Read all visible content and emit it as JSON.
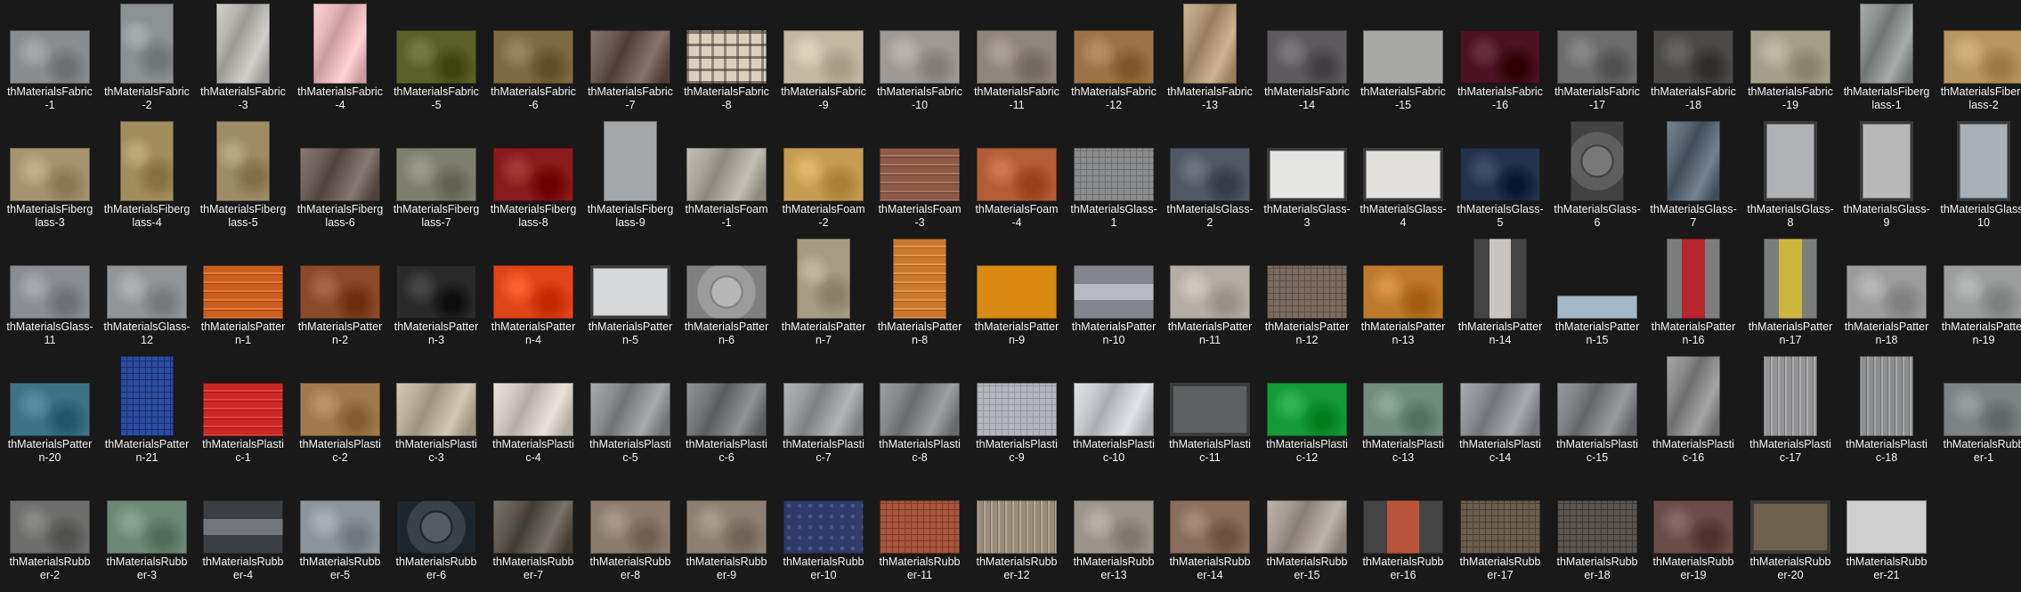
{
  "items": [
    {
      "line1": "thMaterialsFabric",
      "line2": "-1",
      "shape": "wide",
      "color": "#8a8d90",
      "texture": "noise"
    },
    {
      "line1": "thMaterialsFabric",
      "line2": "-2",
      "shape": "tall",
      "color": "#8c9194",
      "texture": "noise"
    },
    {
      "line1": "thMaterialsFabric",
      "line2": "-3",
      "shape": "tall",
      "color": "#b8b6b1",
      "texture": "wrinkle"
    },
    {
      "line1": "thMaterialsFabric",
      "line2": "-4",
      "shape": "tall",
      "color": "#e6b8bc",
      "texture": "wrinkle"
    },
    {
      "line1": "thMaterialsFabric",
      "line2": "-5",
      "shape": "wide",
      "color": "#5a5f2a",
      "texture": "noise"
    },
    {
      "line1": "thMaterialsFabric",
      "line2": "-6",
      "shape": "wide",
      "color": "#7c6a43",
      "texture": "noise"
    },
    {
      "line1": "thMaterialsFabric",
      "line2": "-7",
      "shape": "wide",
      "color": "#6a5a52",
      "texture": "wrinkle"
    },
    {
      "line1": "thMaterialsFabric",
      "line2": "-8",
      "shape": "wide",
      "color": "#d9d1bd",
      "texture": "plaid"
    },
    {
      "line1": "thMaterialsFabric",
      "line2": "-9",
      "shape": "wide",
      "color": "#c5b8a3",
      "texture": "noise"
    },
    {
      "line1": "thMaterialsFabric",
      "line2": "-10",
      "shape": "wide",
      "color": "#9e9994",
      "texture": "noise"
    },
    {
      "line1": "thMaterialsFabric",
      "line2": "-11",
      "shape": "wide",
      "color": "#8f867b",
      "texture": "noise"
    },
    {
      "line1": "thMaterialsFabric",
      "line2": "-12",
      "shape": "wide",
      "color": "#9b7347",
      "texture": "noise"
    },
    {
      "line1": "thMaterialsFabric",
      "line2": "-13",
      "shape": "tall",
      "color": "#b49a7a",
      "texture": "wrinkle"
    },
    {
      "line1": "thMaterialsFabric",
      "line2": "-14",
      "shape": "wide",
      "color": "#5d5b60",
      "texture": "noise"
    },
    {
      "line1": "thMaterialsFabric",
      "line2": "-15",
      "shape": "wide",
      "color": "#a8a8a6",
      "texture": "flat"
    },
    {
      "line1": "thMaterialsFabric",
      "line2": "-16",
      "shape": "wide",
      "color": "#4a1222",
      "texture": "noise"
    },
    {
      "line1": "thMaterialsFabric",
      "line2": "-17",
      "shape": "wide",
      "color": "#6c6c6c",
      "texture": "noise"
    },
    {
      "line1": "thMaterialsFabric",
      "line2": "-18",
      "shape": "wide",
      "color": "#4b4a48",
      "texture": "noise"
    },
    {
      "line1": "thMaterialsFabric",
      "line2": "-19",
      "shape": "wide",
      "color": "#a49f8a",
      "texture": "noise"
    },
    {
      "line1": "thMaterialsFiberg",
      "line2": "lass-1",
      "shape": "tall",
      "color": "#8d9290",
      "texture": "wrinkle"
    },
    {
      "line1": "thMaterialsFiberg",
      "line2": "lass-2",
      "shape": "wide",
      "color": "#b89660",
      "texture": "noise"
    },
    {
      "line1": "thMaterialsFiberg",
      "line2": "lass-3",
      "shape": "wide",
      "color": "#a59470",
      "texture": "noise"
    },
    {
      "line1": "thMaterialsFiberg",
      "line2": "lass-4",
      "shape": "tall",
      "color": "#a08e5c",
      "texture": "noise"
    },
    {
      "line1": "thMaterialsFiberg",
      "line2": "lass-5",
      "shape": "tall",
      "color": "#9d8c66",
      "texture": "noise"
    },
    {
      "line1": "thMaterialsFiberg",
      "line2": "lass-6",
      "shape": "wide",
      "color": "#6c5f59",
      "texture": "wrinkle"
    },
    {
      "line1": "thMaterialsFiberg",
      "line2": "lass-7",
      "shape": "wide",
      "color": "#7e7f6e",
      "texture": "noise"
    },
    {
      "line1": "thMaterialsFiberg",
      "line2": "lass-8",
      "shape": "wide",
      "color": "#8a1a1c",
      "texture": "noise"
    },
    {
      "line1": "thMaterialsFiberg",
      "line2": "lass-9",
      "shape": "tall",
      "color": "#a5a8ab",
      "texture": "flat"
    },
    {
      "line1": "thMaterialsFoam",
      "line2": "-1",
      "shape": "wide",
      "color": "#a9a59b",
      "texture": "wrinkle"
    },
    {
      "line1": "thMaterialsFoam",
      "line2": "-2",
      "shape": "wide",
      "color": "#c69b52",
      "texture": "noise"
    },
    {
      "line1": "thMaterialsFoam",
      "line2": "-3",
      "shape": "wide",
      "color": "#8d5a48",
      "texture": "stripes"
    },
    {
      "line1": "thMaterialsFoam",
      "line2": "-4",
      "shape": "wide",
      "color": "#b25d35",
      "texture": "noise"
    },
    {
      "line1": "thMaterialsGlass-",
      "line2": "1",
      "shape": "wide",
      "color": "#8a8b8d",
      "texture": "grid"
    },
    {
      "line1": "thMaterialsGlass-",
      "line2": "2",
      "shape": "wide",
      "color": "#505866",
      "texture": "noise"
    },
    {
      "line1": "thMaterialsGlass-",
      "line2": "3",
      "shape": "wide",
      "color": "#e5e5e3",
      "texture": "frame"
    },
    {
      "line1": "thMaterialsGlass-",
      "line2": "4",
      "shape": "wide",
      "color": "#e1e0dc",
      "texture": "frame"
    },
    {
      "line1": "thMaterialsGlass-",
      "line2": "5",
      "shape": "wide",
      "color": "#24324b",
      "texture": "noise"
    },
    {
      "line1": "thMaterialsGlass-",
      "line2": "6",
      "shape": "tall",
      "color": "#5d5e5d",
      "texture": "circle"
    },
    {
      "line1": "thMaterialsGlass-",
      "line2": "7",
      "shape": "tall",
      "color": "#5b6976",
      "texture": "wrinkle"
    },
    {
      "line1": "thMaterialsGlass-",
      "line2": "8",
      "shape": "tall",
      "color": "#b0b2b5",
      "texture": "frame"
    },
    {
      "line1": "thMaterialsGlass-",
      "line2": "9",
      "shape": "tall",
      "color": "#b8b8b8",
      "texture": "frame"
    },
    {
      "line1": "thMaterialsGlass-",
      "line2": "10",
      "shape": "tall",
      "color": "#a8b0b8",
      "texture": "frame"
    },
    {
      "line1": "thMaterialsGlass-",
      "line2": "11",
      "shape": "wide",
      "color": "#8a8d91",
      "texture": "noise"
    },
    {
      "line1": "thMaterialsGlass-",
      "line2": "12",
      "shape": "wide",
      "color": "#939699",
      "texture": "noise"
    },
    {
      "line1": "thMaterialsPatter",
      "line2": "n-1",
      "shape": "wide",
      "color": "#c95f22",
      "texture": "stripes"
    },
    {
      "line1": "thMaterialsPatter",
      "line2": "n-2",
      "shape": "wide",
      "color": "#8b4a2b",
      "texture": "noise"
    },
    {
      "line1": "thMaterialsPatter",
      "line2": "n-3",
      "shape": "wide",
      "color": "#2a2a2a",
      "texture": "noise"
    },
    {
      "line1": "thMaterialsPatter",
      "line2": "n-4",
      "shape": "wide",
      "color": "#e04419",
      "texture": "noise"
    },
    {
      "line1": "thMaterialsPatter",
      "line2": "n-5",
      "shape": "wide",
      "color": "#d8d9db",
      "texture": "frame"
    },
    {
      "line1": "thMaterialsPatter",
      "line2": "n-6",
      "shape": "wide",
      "color": "#9c9c9c",
      "texture": "circle"
    },
    {
      "line1": "thMaterialsPatter",
      "line2": "n-7",
      "shape": "tall",
      "color": "#a69c86",
      "texture": "noise"
    },
    {
      "line1": "thMaterialsPatter",
      "line2": "n-8",
      "shape": "tall",
      "color": "#c9792e",
      "texture": "stripes"
    },
    {
      "line1": "thMaterialsPatter",
      "line2": "n-9",
      "shape": "wide",
      "color": "#d88a12",
      "texture": "flat"
    },
    {
      "line1": "thMaterialsPatter",
      "line2": "n-10",
      "shape": "wide",
      "color": "#9ea2a8",
      "texture": "band"
    },
    {
      "line1": "thMaterialsPatter",
      "line2": "n-11",
      "shape": "wide",
      "color": "#b3ada3",
      "texture": "noise"
    },
    {
      "line1": "thMaterialsPatter",
      "line2": "n-12",
      "shape": "wide",
      "color": "#7a6a5f",
      "texture": "grid"
    },
    {
      "line1": "thMaterialsPatter",
      "line2": "n-13",
      "shape": "wide",
      "color": "#bd7a2d",
      "texture": "noise"
    },
    {
      "line1": "thMaterialsPatter",
      "line2": "n-14",
      "shape": "tall",
      "color": "#c8c4bf",
      "texture": "cone"
    },
    {
      "line1": "thMaterialsPatter",
      "line2": "n-15",
      "shape": "low",
      "color": "#a5b8c8",
      "texture": "flat"
    },
    {
      "line1": "thMaterialsPatter",
      "line2": "n-16",
      "shape": "tall",
      "color": "#b4262b",
      "texture": "band-v"
    },
    {
      "line1": "thMaterialsPatter",
      "line2": "n-17",
      "shape": "tall",
      "color": "#cdb63b",
      "texture": "band-v"
    },
    {
      "line1": "thMaterialsPatter",
      "line2": "n-18",
      "shape": "wide",
      "color": "#9c9c9c",
      "texture": "noise"
    },
    {
      "line1": "thMaterialsPatter",
      "line2": "n-19",
      "shape": "wide",
      "color": "#9b9d9d",
      "texture": "noise"
    },
    {
      "line1": "thMaterialsPatter",
      "line2": "n-20",
      "shape": "wide",
      "color": "#3f7184",
      "texture": "noise"
    },
    {
      "line1": "thMaterialsPatter",
      "line2": "n-21",
      "shape": "tall",
      "color": "#2e4c9a",
      "texture": "grid"
    },
    {
      "line1": "thMaterialsPlasti",
      "line2": "c-1",
      "shape": "wide",
      "color": "#c72a28",
      "texture": "stripes"
    },
    {
      "line1": "thMaterialsPlasti",
      "line2": "c-2",
      "shape": "wide",
      "color": "#9e7a4e",
      "texture": "noise"
    },
    {
      "line1": "thMaterialsPlasti",
      "line2": "c-3",
      "shape": "wide",
      "color": "#b7ae9c",
      "texture": "wrinkle"
    },
    {
      "line1": "thMaterialsPlasti",
      "line2": "c-4",
      "shape": "wide",
      "color": "#cfc9c1",
      "texture": "wrinkle"
    },
    {
      "line1": "thMaterialsPlasti",
      "line2": "c-5",
      "shape": "wide",
      "color": "#8e8f93",
      "texture": "wrinkle"
    },
    {
      "line1": "thMaterialsPlasti",
      "line2": "c-6",
      "shape": "wide",
      "color": "#77787c",
      "texture": "wrinkle"
    },
    {
      "line1": "thMaterialsPlasti",
      "line2": "c-7",
      "shape": "wide",
      "color": "#9a9b9e",
      "texture": "wrinkle"
    },
    {
      "line1": "thMaterialsPlasti",
      "line2": "c-8",
      "shape": "wide",
      "color": "#85868a",
      "texture": "wrinkle"
    },
    {
      "line1": "thMaterialsPlasti",
      "line2": "c-9",
      "shape": "wide",
      "color": "#b4b6bd",
      "texture": "grid"
    },
    {
      "line1": "thMaterialsPlasti",
      "line2": "c-10",
      "shape": "wide",
      "color": "#c7c9cf",
      "texture": "wrinkle"
    },
    {
      "line1": "thMaterialsPlasti",
      "line2": "c-11",
      "shape": "wide",
      "color": "#5f6062",
      "texture": "frame"
    },
    {
      "line1": "thMaterialsPlasti",
      "line2": "c-12",
      "shape": "wide",
      "color": "#159a3a",
      "texture": "noise"
    },
    {
      "line1": "thMaterialsPlasti",
      "line2": "c-13",
      "shape": "wide",
      "color": "#708c7d",
      "texture": "noise"
    },
    {
      "line1": "thMaterialsPlasti",
      "line2": "c-14",
      "shape": "wide",
      "color": "#8e9095",
      "texture": "wrinkle"
    },
    {
      "line1": "thMaterialsPlasti",
      "line2": "c-15",
      "shape": "wide",
      "color": "#7f8185",
      "texture": "wrinkle"
    },
    {
      "line1": "thMaterialsPlasti",
      "line2": "c-16",
      "shape": "tall",
      "color": "#8b8b8c",
      "texture": "wrinkle"
    },
    {
      "line1": "thMaterialsPlasti",
      "line2": "c-17",
      "shape": "tall",
      "color": "#939395",
      "texture": "stripes-v"
    },
    {
      "line1": "thMaterialsPlasti",
      "line2": "c-18",
      "shape": "tall",
      "color": "#8d8e90",
      "texture": "stripes-v"
    },
    {
      "line1": "thMaterialsRubb",
      "line2": "er-1",
      "shape": "wide",
      "color": "#7d8384",
      "texture": "noise"
    },
    {
      "line1": "thMaterialsRubb",
      "line2": "er-2",
      "shape": "wide",
      "color": "#6d6d6c",
      "texture": "noise"
    },
    {
      "line1": "thMaterialsRubb",
      "line2": "er-3",
      "shape": "wide",
      "color": "#6e8878",
      "texture": "noise"
    },
    {
      "line1": "thMaterialsRubb",
      "line2": "er-4",
      "shape": "wide",
      "color": "#585b60",
      "texture": "band"
    },
    {
      "line1": "thMaterialsRubb",
      "line2": "er-5",
      "shape": "wide",
      "color": "#8d949b",
      "texture": "noise"
    },
    {
      "line1": "thMaterialsRubb",
      "line2": "er-6",
      "shape": "wide",
      "color": "#3a4247",
      "texture": "circle"
    },
    {
      "line1": "thMaterialsRubb",
      "line2": "er-7",
      "shape": "wide",
      "color": "#5e5851",
      "texture": "wrinkle"
    },
    {
      "line1": "thMaterialsRubb",
      "line2": "er-8",
      "shape": "wide",
      "color": "#8b7c6d",
      "texture": "noise"
    },
    {
      "line1": "thMaterialsRubb",
      "line2": "er-9",
      "shape": "wide",
      "color": "#8d8072",
      "texture": "noise"
    },
    {
      "line1": "thMaterialsRubb",
      "line2": "er-10",
      "shape": "wide",
      "color": "#2f3b6b",
      "texture": "dots"
    },
    {
      "line1": "thMaterialsRubb",
      "line2": "er-11",
      "shape": "wide",
      "color": "#a4573e",
      "texture": "grid"
    },
    {
      "line1": "thMaterialsRubb",
      "line2": "er-12",
      "shape": "wide",
      "color": "#9a8d7c",
      "texture": "stripes-v"
    },
    {
      "line1": "thMaterialsRubb",
      "line2": "er-13",
      "shape": "wide",
      "color": "#9a948a",
      "texture": "noise"
    },
    {
      "line1": "thMaterialsRubb",
      "line2": "er-14",
      "shape": "wide",
      "color": "#8a6e5c",
      "texture": "noise"
    },
    {
      "line1": "thMaterialsRubb",
      "line2": "er-15",
      "shape": "wide",
      "color": "#a39a91",
      "texture": "wrinkle"
    },
    {
      "line1": "thMaterialsRubb",
      "line2": "er-16",
      "shape": "wide",
      "color": "#b8563c",
      "texture": "cone"
    },
    {
      "line1": "thMaterialsRubb",
      "line2": "er-17",
      "shape": "wide",
      "color": "#6b5d4e",
      "texture": "grid"
    },
    {
      "line1": "thMaterialsRubb",
      "line2": "er-18",
      "shape": "wide",
      "color": "#5a5450",
      "texture": "grid"
    },
    {
      "line1": "thMaterialsRubb",
      "line2": "er-19",
      "shape": "wide",
      "color": "#6a4c48",
      "texture": "noise"
    },
    {
      "line1": "thMaterialsRubb",
      "line2": "er-20",
      "shape": "wide",
      "color": "#6e6150",
      "texture": "frame"
    },
    {
      "line1": "thMaterialsRubb",
      "line2": "er-21",
      "shape": "wide",
      "color": "#cfcfcf",
      "texture": "flat"
    }
  ]
}
